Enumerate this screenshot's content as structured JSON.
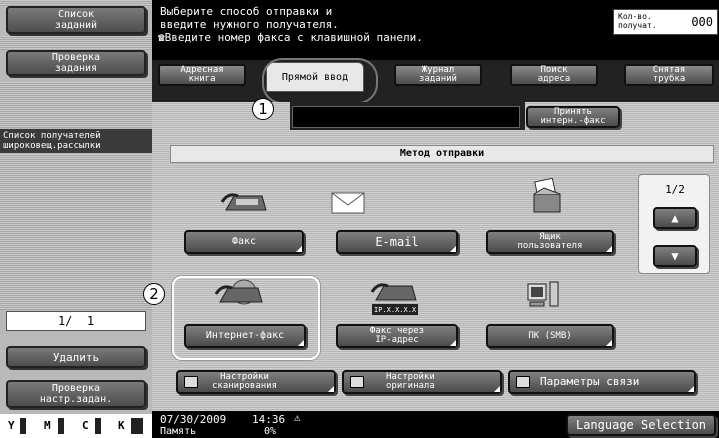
{
  "sidebar": {
    "job_list": "Список\nзаданий",
    "check_job": "Проверка\nзадания",
    "recipient_list": "Список получателей\nшироковещ.рассылки",
    "page": "1/  1",
    "delete": "Удалить",
    "check_settings": "Проверка\nнастр.задан.",
    "toner": [
      "Y",
      "M",
      "C",
      "K"
    ]
  },
  "banner": {
    "line1": "Выберите способ отправки и",
    "line2": "введите нужного получателя.",
    "line3": "Введите номер факса с клавишной панели.",
    "counter_label": "Кол-во.\nполучат.",
    "counter_value": "000"
  },
  "tabs": [
    {
      "label": "Адресная\nкнига"
    },
    {
      "label": "Прямой ввод"
    },
    {
      "label": "Журнал\nзаданий"
    },
    {
      "label": "Поиск\nадреса"
    },
    {
      "label": "Снятая\nтрубка"
    }
  ],
  "accept_ifax": "Принять\nинтерн.-факс",
  "method_header": "Метод отправки",
  "page_indicator": "1/2",
  "methods": [
    {
      "label": "Факс",
      "icon": "fax-icon"
    },
    {
      "label": "E-mail",
      "icon": "envelope-icon"
    },
    {
      "label": "Ящик\nпользователя",
      "icon": "user-box-icon"
    },
    {
      "label": "Интернет-факс",
      "icon": "internet-fax-icon"
    },
    {
      "label": "Факс через\nIP-адрес",
      "icon": "ip-fax-icon"
    },
    {
      "label": "ПК (SMB)",
      "icon": "pc-icon"
    }
  ],
  "ip_icon_text": "IP.X.X.X.X",
  "bottom_buttons": [
    {
      "label": "Настройки\nсканирования"
    },
    {
      "label": "Настройки\nоригинала"
    },
    {
      "label": "Параметры связи"
    }
  ],
  "status": {
    "date": "07/30/2009",
    "time": "14:36",
    "memory_label": "Память",
    "memory_value": "0%",
    "language": "Language Selection"
  },
  "callouts": [
    "1",
    "2"
  ]
}
